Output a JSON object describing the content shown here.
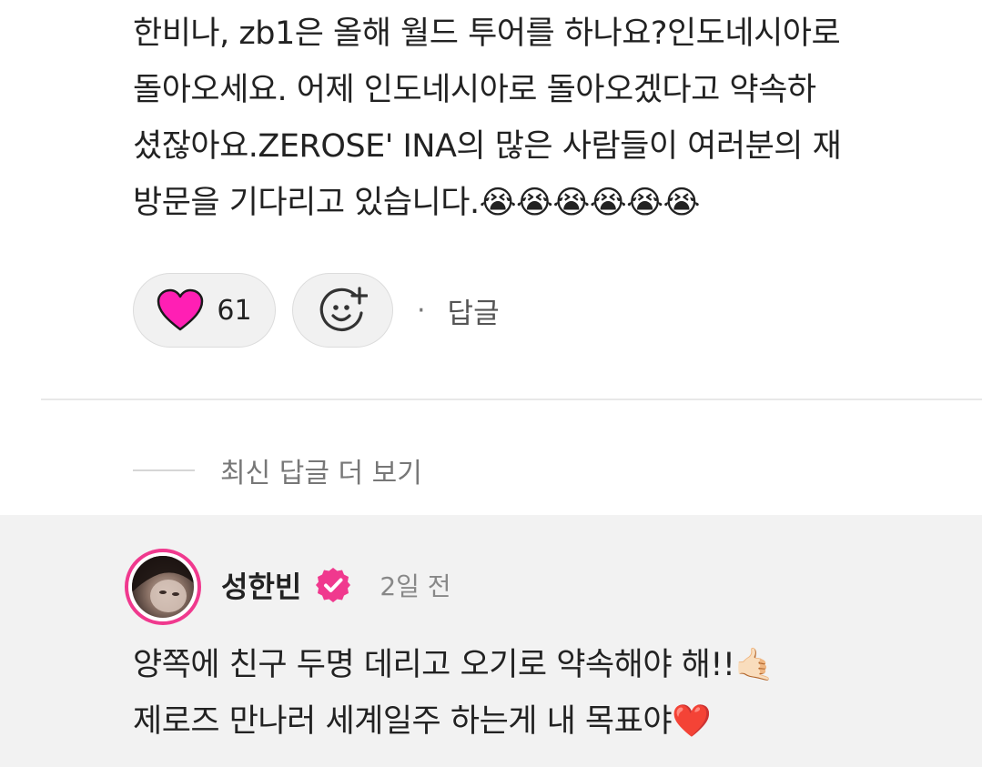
{
  "comment": {
    "lines": [
      "한비나, zb1은 올해 월드 투어를 하나요?인도네시아로",
      "돌아오세요. 어제 인도네시아로 돌아오겠다고 약속하",
      "셨잖아요.ZEROSE' INA의 많은 사람들이 여러분의 재",
      "방문을 기다리고 있습니다.😭😭😭😭😭😭"
    ],
    "like_count": "61",
    "reply_label": "답글",
    "separator": "·"
  },
  "more_replies": {
    "label": "최신 답글 더 보기"
  },
  "reply": {
    "author": "성한빈",
    "time": "2일 전",
    "lines": [
      "양쪽에 친구 두명 데리고 오기로 약속해야 해!!🤙🏻",
      "제로즈 만나러 세계일주 하는게 내 목표야❤️"
    ]
  },
  "icons": {
    "like": "heart-icon",
    "react": "add-emoji-icon",
    "verified": "verified-badge-icon",
    "avatar": "profile-photo"
  },
  "colors": {
    "heart": "#ff1fb4",
    "brand_pink": "#f0398e",
    "reply_bg": "#f2f2f2"
  }
}
